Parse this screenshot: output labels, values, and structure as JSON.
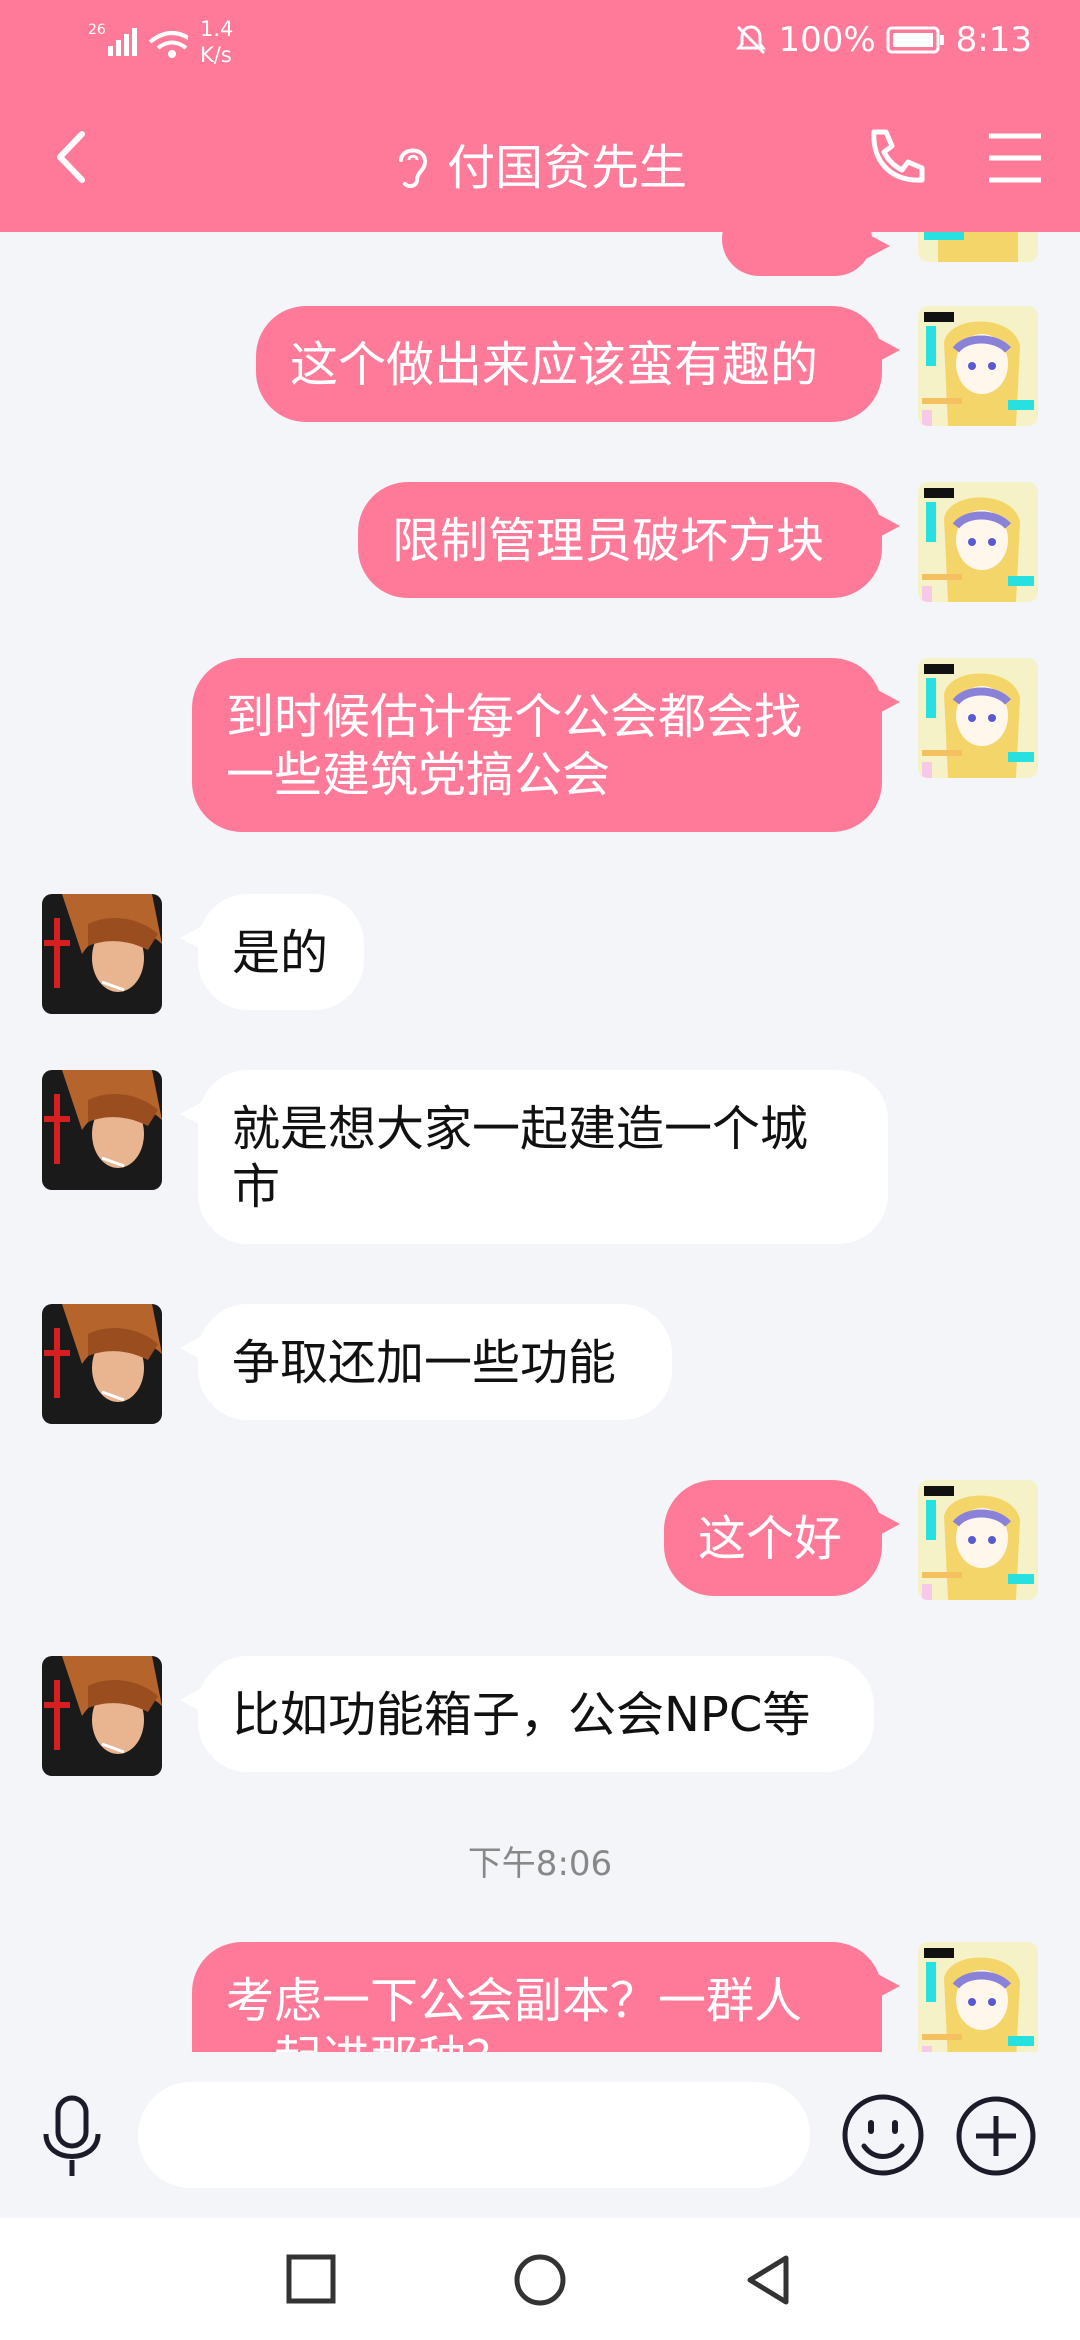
{
  "status_bar": {
    "signal": "26",
    "net_speed": "1.4",
    "net_unit": "K/s",
    "battery": "100%",
    "time": "8:13"
  },
  "header": {
    "title": "付国贫先生",
    "icons": [
      "back-arrow-icon",
      "ear-icon",
      "phone-icon",
      "menu-icon"
    ]
  },
  "messages": [
    {
      "side": "me",
      "text": "这个做出来应该蛮有趣的"
    },
    {
      "side": "me",
      "text": "限制管理员破坏方块"
    },
    {
      "side": "me",
      "text": "到时候估计每个公会都会找一些建筑党搞公会"
    },
    {
      "side": "them",
      "text": "是的"
    },
    {
      "side": "them",
      "text": "就是想大家一起建造一个城市"
    },
    {
      "side": "them",
      "text": "争取还加一些功能"
    },
    {
      "side": "me",
      "text": "这个好"
    },
    {
      "side": "them",
      "text": "比如功能箱子，公会NPC等"
    },
    {
      "side": "me",
      "text": "考虑一下公会副本？一群人一起进那种？"
    }
  ],
  "timestamp": "下午8:06",
  "input": {
    "placeholder": ""
  },
  "colors": {
    "accent": "#ff7a98",
    "background": "#f4f5f9"
  }
}
